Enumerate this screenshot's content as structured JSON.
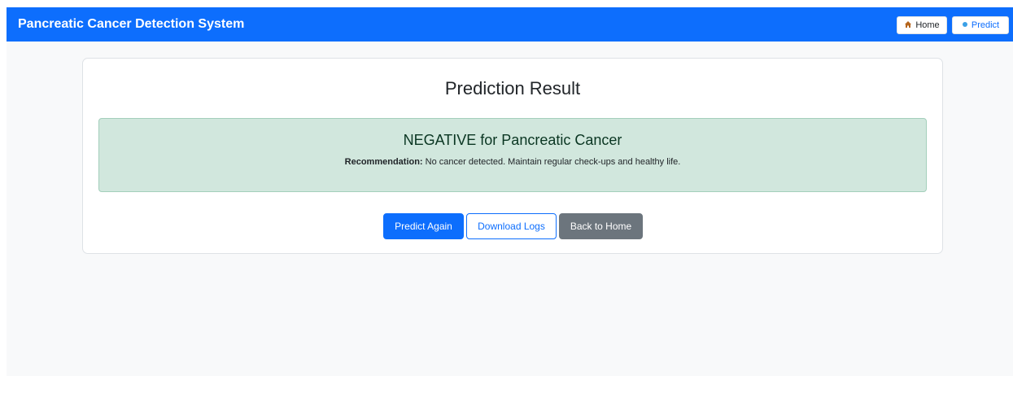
{
  "navbar": {
    "brand": "Pancreatic Cancer Detection System",
    "links": [
      {
        "label": "Home",
        "icon": "house-icon"
      },
      {
        "label": "Predict",
        "icon": "dot-icon"
      }
    ]
  },
  "result": {
    "title": "Prediction Result",
    "heading": "NEGATIVE for Pancreatic Cancer",
    "recommendation_label": "Recommendation:",
    "recommendation_text": "No cancer detected. Maintain regular check-ups and healthy life."
  },
  "actions": {
    "predict_again": "Predict Again",
    "download_logs": "Download Logs",
    "back_home": "Back to Home"
  },
  "colors": {
    "primary": "#0d6efd",
    "success_bg": "#d1e7dd",
    "success_text": "#0a3622",
    "secondary": "#6c757d",
    "page_bg": "#f8f9fa"
  }
}
